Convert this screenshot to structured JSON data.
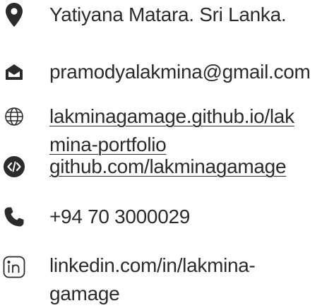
{
  "contact": {
    "location": "Yatiyana Matara. Sri Lanka.",
    "email": "pramodyalakmina@gmail.com",
    "portfolio_line1": "lakminagamage.github.io/lak",
    "portfolio_line2": "mina-portfolio",
    "github": "github.com/lakminagamage",
    "phone": "+94 70 3000029",
    "linkedin_line1": "linkedin.com/in/lakmina-",
    "linkedin_line2": "gamage"
  },
  "icons": {
    "location": "map-pin-icon",
    "email": "envelope-open-icon",
    "portfolio": "globe-icon",
    "github": "code-icon",
    "phone": "phone-icon",
    "linkedin": "linkedin-icon"
  },
  "colors": {
    "text": "#2b2b2b",
    "icon": "#2b2b2b",
    "background": "#ffffff"
  }
}
